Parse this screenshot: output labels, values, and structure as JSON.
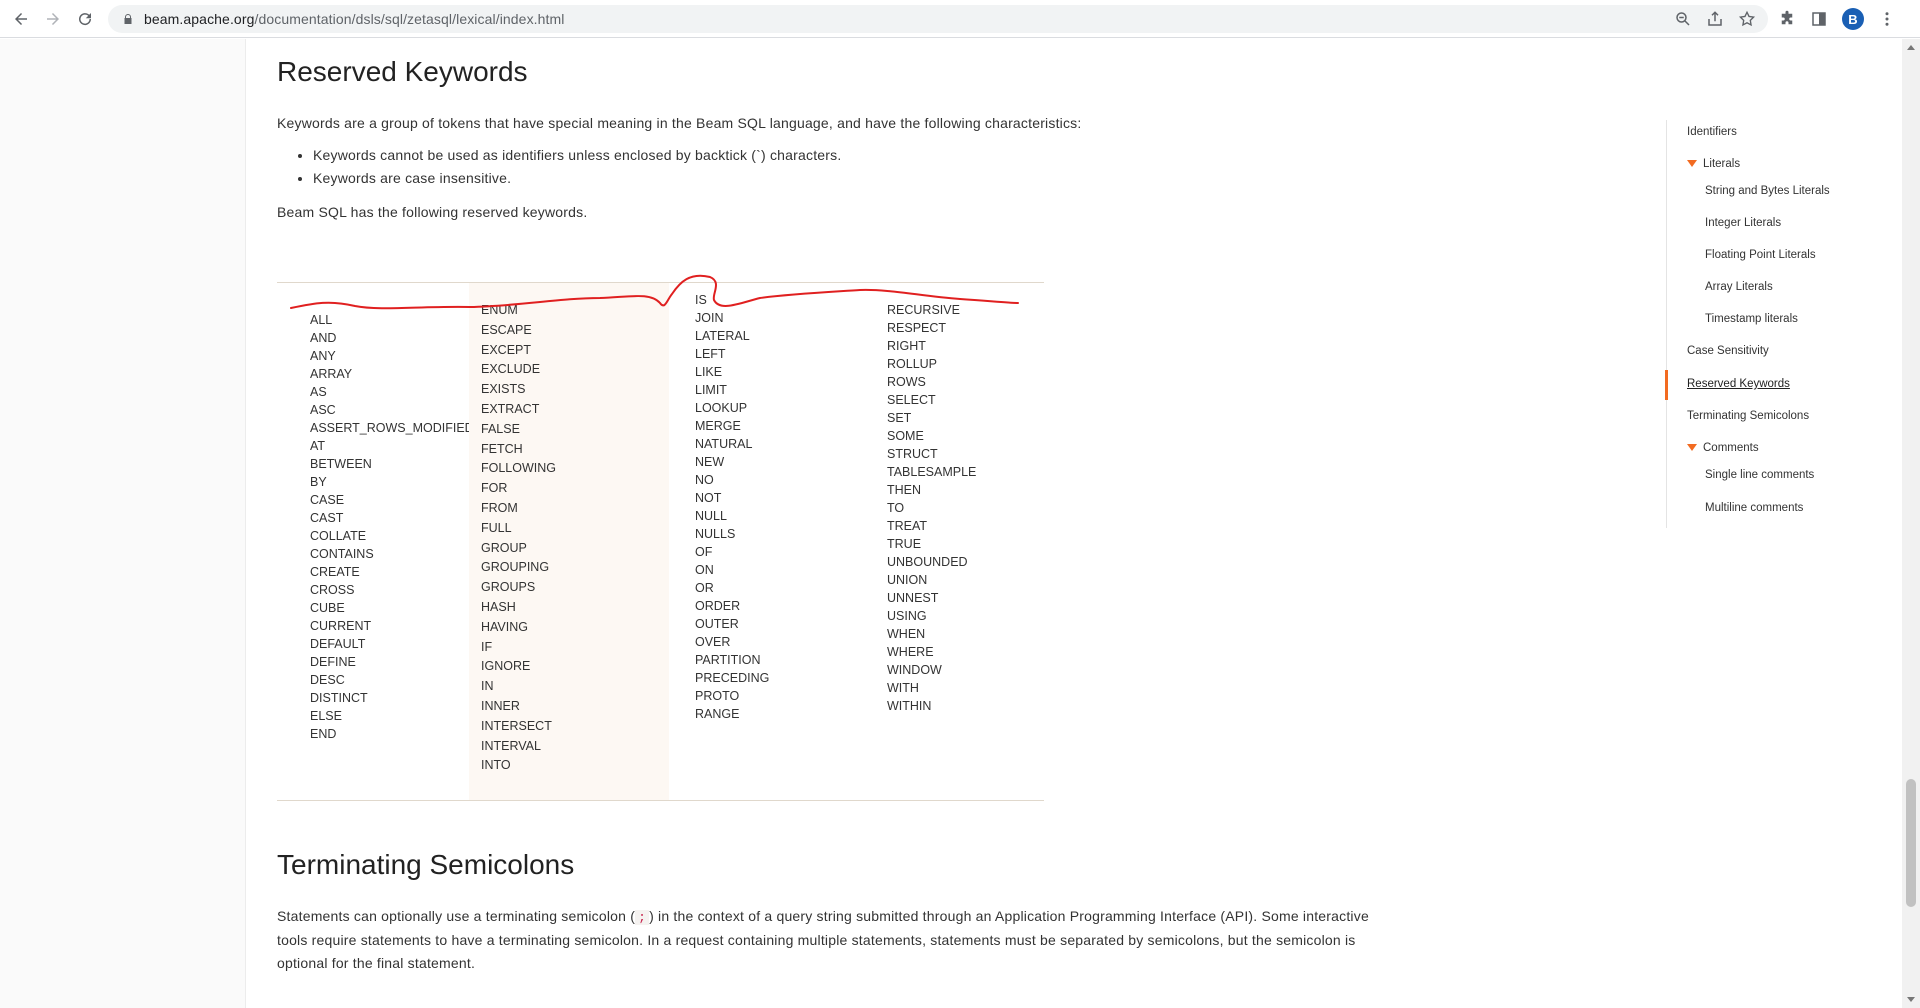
{
  "browser": {
    "url_host": "beam.apache.org",
    "url_path": "/documentation/dsls/sql/zetasql/lexical/index.html",
    "avatar_letter": "B"
  },
  "section_reserved": {
    "title": "Reserved Keywords",
    "intro": "Keywords are a group of tokens that have special meaning in the Beam SQL language, and have the following characteristics:",
    "bullets": [
      "Keywords cannot be used as identifiers unless enclosed by backtick (`) characters.",
      "Keywords are case insensitive."
    ],
    "list_intro": "Beam SQL has the following reserved keywords."
  },
  "keywords": {
    "col1": [
      "ALL",
      "AND",
      "ANY",
      "ARRAY",
      "AS",
      "ASC",
      "ASSERT_ROWS_MODIFIED",
      "AT",
      "BETWEEN",
      "BY",
      "CASE",
      "CAST",
      "COLLATE",
      "CONTAINS",
      "CREATE",
      "CROSS",
      "CUBE",
      "CURRENT",
      "DEFAULT",
      "DEFINE",
      "DESC",
      "DISTINCT",
      "ELSE",
      "END"
    ],
    "col2": [
      "ENUM",
      "ESCAPE",
      "EXCEPT",
      "EXCLUDE",
      "EXISTS",
      "EXTRACT",
      "FALSE",
      "FETCH",
      "FOLLOWING",
      "FOR",
      "FROM",
      "FULL",
      "GROUP",
      "GROUPING",
      "GROUPS",
      "HASH",
      "HAVING",
      "IF",
      "IGNORE",
      "IN",
      "INNER",
      "INTERSECT",
      "INTERVAL",
      "INTO"
    ],
    "col3": [
      "IS",
      "JOIN",
      "LATERAL",
      "LEFT",
      "LIKE",
      "LIMIT",
      "LOOKUP",
      "MERGE",
      "NATURAL",
      "NEW",
      "NO",
      "NOT",
      "NULL",
      "NULLS",
      "OF",
      "ON",
      "OR",
      "ORDER",
      "OUTER",
      "OVER",
      "PARTITION",
      "PRECEDING",
      "PROTO",
      "RANGE"
    ],
    "col4": [
      "RECURSIVE",
      "RESPECT",
      "RIGHT",
      "ROLLUP",
      "ROWS",
      "SELECT",
      "SET",
      "SOME",
      "STRUCT",
      "TABLESAMPLE",
      "THEN",
      "TO",
      "TREAT",
      "TRUE",
      "UNBOUNDED",
      "UNION",
      "UNNEST",
      "USING",
      "WHEN",
      "WHERE",
      "WINDOW",
      "WITH",
      "WITHIN"
    ]
  },
  "section_terminating": {
    "title": "Terminating Semicolons",
    "para_before": "Statements can optionally use a terminating semicolon (",
    "code": ";",
    "para_after": ") in the context of a query string submitted through an Application Programming Interface (API). Some interactive tools require statements to have a terminating semicolon. In a request containing multiple statements, statements must be separated by semicolons, but the semicolon is optional for the final statement."
  },
  "toc": {
    "identifiers": "Identifiers",
    "literals": "Literals",
    "string_bytes": "String and Bytes Literals",
    "integer": "Integer Literals",
    "floating": "Floating Point Literals",
    "array": "Array Literals",
    "timestamp": "Timestamp literals",
    "case_sensitivity": "Case Sensitivity",
    "reserved": "Reserved Keywords",
    "terminating": "Terminating Semicolons",
    "comments": "Comments",
    "single_line": "Single line comments",
    "multiline": "Multiline comments"
  },
  "colors": {
    "accent": "#f26b21",
    "annotation": "#e02020",
    "code": "#c7254e",
    "avatar": "#1a5fb4"
  }
}
